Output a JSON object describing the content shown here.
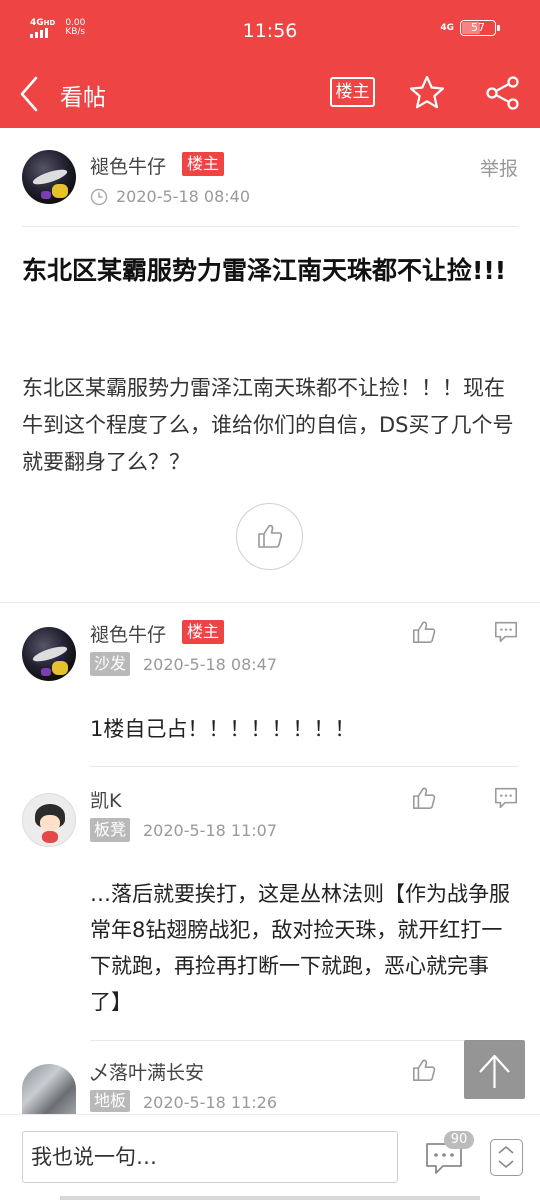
{
  "status_bar": {
    "network": "4G",
    "network_sub": "HD",
    "speed_value": "0.00",
    "speed_unit": "KB/s",
    "time": "11:56",
    "right_network": "4G",
    "battery_level": "57",
    "battery_fraction": 0.57
  },
  "header": {
    "title": "看帖",
    "owner_only_label": "楼主",
    "icons": [
      "back-icon",
      "star-icon",
      "share-icon"
    ],
    "color": "#ef4444"
  },
  "post": {
    "author": "褪色牛仔",
    "author_badge": "楼主",
    "time": "2020-5-18 08:40",
    "report_label": "举报",
    "title": "东北区某霸服势力雷泽江南天珠都不让捡!!!",
    "body": "东北区某霸服势力雷泽江南天珠都不让捡！！！现在牛到这个程度了么，谁给你们的自信，DS买了几个号就要翻身了么？？"
  },
  "replies": [
    {
      "author": "褪色牛仔",
      "author_badge": "楼主",
      "floor": "沙发",
      "time": "2020-5-18 08:47",
      "text": "1楼自己占！！！！！！！！"
    },
    {
      "author": "凯K",
      "floor": "板凳",
      "time": "2020-5-18 11:07",
      "text": "…落后就要挨打，这是丛林法则【作为战争服常年8钻翅膀战犯，敌对捡天珠，就开红打一下就跑，再捡再打断一下就跑，恶心就完事了】"
    },
    {
      "author": "乄落叶满长安",
      "floor": "地板",
      "time": "2020-5-18 11:26",
      "text": ""
    }
  ],
  "bottom_bar": {
    "input_placeholder": "我也说一句…",
    "comment_count": "90"
  }
}
